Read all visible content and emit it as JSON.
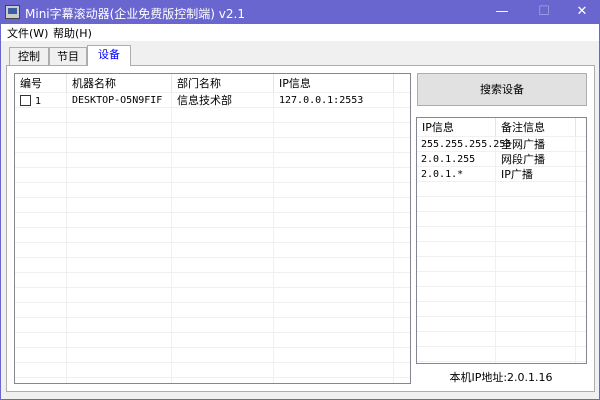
{
  "window": {
    "title": "Mini字幕滚动器(企业免费版控制端) v2.1",
    "minimize": "—",
    "maximize": "☐",
    "close": "✕"
  },
  "menu": [
    {
      "label": "文件(W)"
    },
    {
      "label": "帮助(H)"
    }
  ],
  "tabs": [
    {
      "label": "控制"
    },
    {
      "label": "节目"
    },
    {
      "label": "设备",
      "active": true
    }
  ],
  "devices": {
    "columns": [
      "编号",
      "机器名称",
      "部门名称",
      "IP信息"
    ],
    "rows": [
      {
        "id": "1",
        "name": "DESKTOP-O5N9FIF",
        "dept": "信息技术部",
        "ip": "127.0.0.1:2553",
        "checked": false
      }
    ]
  },
  "search_button": "搜索设备",
  "broadcast": {
    "columns": [
      "IP信息",
      "备注信息"
    ],
    "rows": [
      [
        "255.255.255.255",
        "全网广播"
      ],
      [
        "2.0.1.255",
        "网段广播"
      ],
      [
        "2.0.1.*",
        "IP广播"
      ]
    ]
  },
  "status": "本机IP地址:2.0.1.16"
}
